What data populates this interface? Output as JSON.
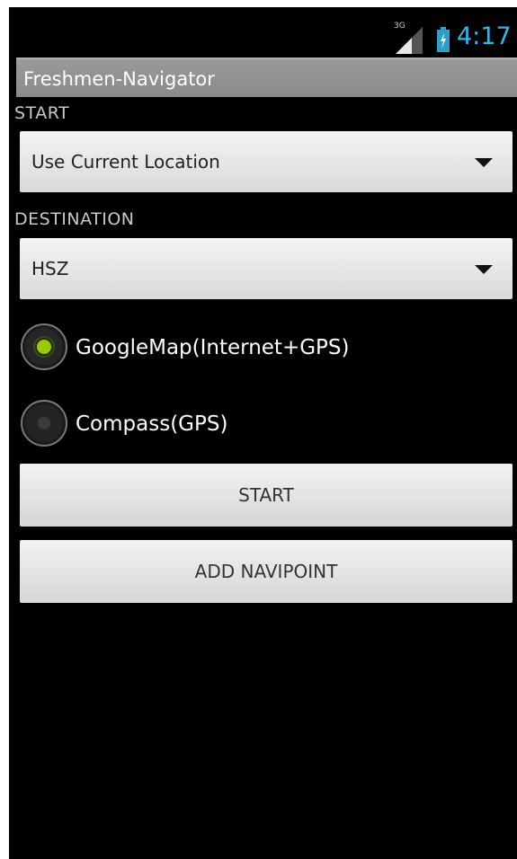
{
  "status_bar": {
    "network_label": "3G",
    "time": "4:17",
    "accent_color": "#33b5e5"
  },
  "app": {
    "title": "Freshmen-Navigator"
  },
  "start": {
    "label": "START",
    "selected_value": "Use Current Location"
  },
  "destination": {
    "label": "DESTINATION",
    "selected_value": "HSZ"
  },
  "modes": [
    {
      "label": "GoogleMap(Internet+GPS)",
      "checked": true
    },
    {
      "label": "Compass(GPS)",
      "checked": false
    }
  ],
  "buttons": {
    "start_label": "START",
    "add_navipoint_label": "ADD NAVIPOINT"
  },
  "icons": {
    "signal": "signal-strength-icon",
    "battery": "battery-icon",
    "dropdown": "dropdown-triangle-icon"
  }
}
